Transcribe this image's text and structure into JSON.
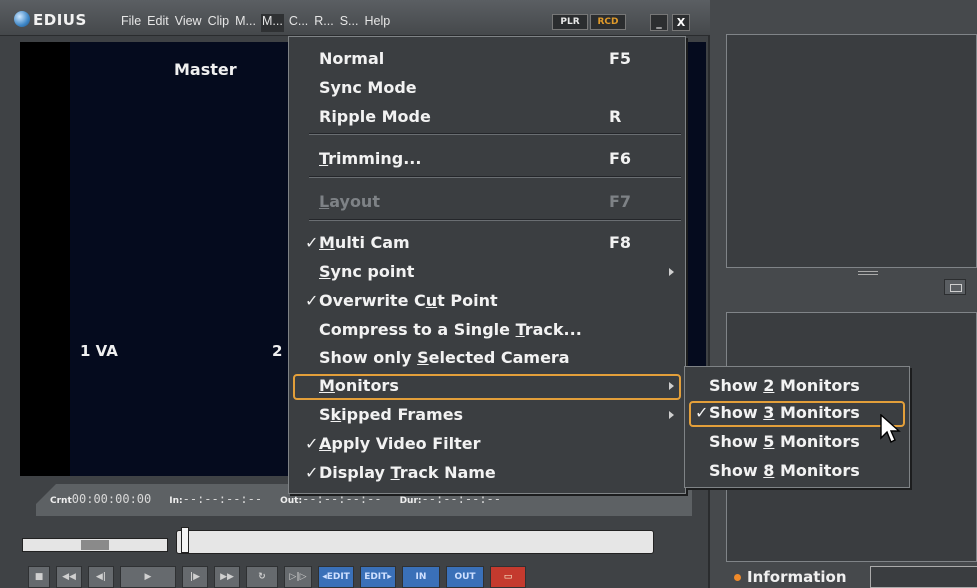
{
  "window": {
    "app_name": "EDIUS",
    "menu": [
      "File",
      "Edit",
      "View",
      "Clip",
      "M...",
      "M...",
      "C...",
      "R...",
      "S...",
      "Help"
    ],
    "plr_label": "PLR",
    "rcd_label": "RCD",
    "minimize_glyph": "_",
    "close_glyph": "X"
  },
  "preview": {
    "master_label": "Master",
    "cam1_label": "1 VA",
    "cam2_label": "2"
  },
  "timecode": {
    "crnt_label": "Crnt",
    "crnt_value": "00:00:00:00",
    "in_label": "In",
    "in_value": "--:--:--:--",
    "out_label": "Out",
    "out_value": "--:--:--:--",
    "dur_label": "Dur",
    "dur_value": "--:--:--:--"
  },
  "transport": {
    "edit_in": "◂EDIT",
    "edit_out": "EDIT▸",
    "in_label": "IN",
    "out_label": "OUT"
  },
  "mode_menu": {
    "items": [
      {
        "label": "Normal",
        "shortcut": "F5"
      },
      {
        "label": "Sync Mode",
        "shortcut": ""
      },
      {
        "label": "Ripple Mode",
        "shortcut": "R"
      },
      {
        "label_pre": "",
        "label_u": "T",
        "label_post": "rimming...",
        "shortcut": "F6"
      },
      {
        "label_pre": "",
        "label_u": "L",
        "label_post": "ayout",
        "shortcut": "F7",
        "disabled": true
      },
      {
        "label_pre": "",
        "label_u": "M",
        "label_post": "ulti Cam",
        "shortcut": "F8",
        "checked": true
      },
      {
        "label_pre": "",
        "label_u": "S",
        "label_post": "ync point",
        "submenu": true
      },
      {
        "label_pre": "Overwrite C",
        "label_u": "u",
        "label_post": "t Point",
        "checked": true
      },
      {
        "label_pre": "Compress to a Single ",
        "label_u": "T",
        "label_post": "rack..."
      },
      {
        "label_pre": "Show only ",
        "label_u": "S",
        "label_post": "elected Camera"
      },
      {
        "label_pre": "",
        "label_u": "M",
        "label_post": "onitors",
        "submenu": true,
        "highlighted": true
      },
      {
        "label_pre": "S",
        "label_u": "k",
        "label_post": "ipped Frames",
        "submenu": true
      },
      {
        "label_pre": "",
        "label_u": "A",
        "label_post": "pply Video Filter",
        "checked": true
      },
      {
        "label_pre": "Display ",
        "label_u": "T",
        "label_post": "rack Name",
        "checked": true
      }
    ]
  },
  "monitors_submenu": {
    "items": [
      {
        "pre": "Show ",
        "num": "2",
        "post": " Monitors",
        "checked": false
      },
      {
        "pre": "Show ",
        "num": "3",
        "post": " Monitors",
        "checked": true
      },
      {
        "pre": "Show ",
        "num": "5",
        "post": " Monitors",
        "checked": false
      },
      {
        "pre": "Show ",
        "num": "8",
        "post": " Monitors",
        "checked": false
      }
    ]
  },
  "right_panel": {
    "info_tab": "Information"
  },
  "check_glyph": "✓",
  "colors": {
    "highlight_border": "#e39f3a",
    "menu_bg": "#3b3e41",
    "preview_bg": "#050b1e",
    "rcd_text": "#e09a2a"
  }
}
